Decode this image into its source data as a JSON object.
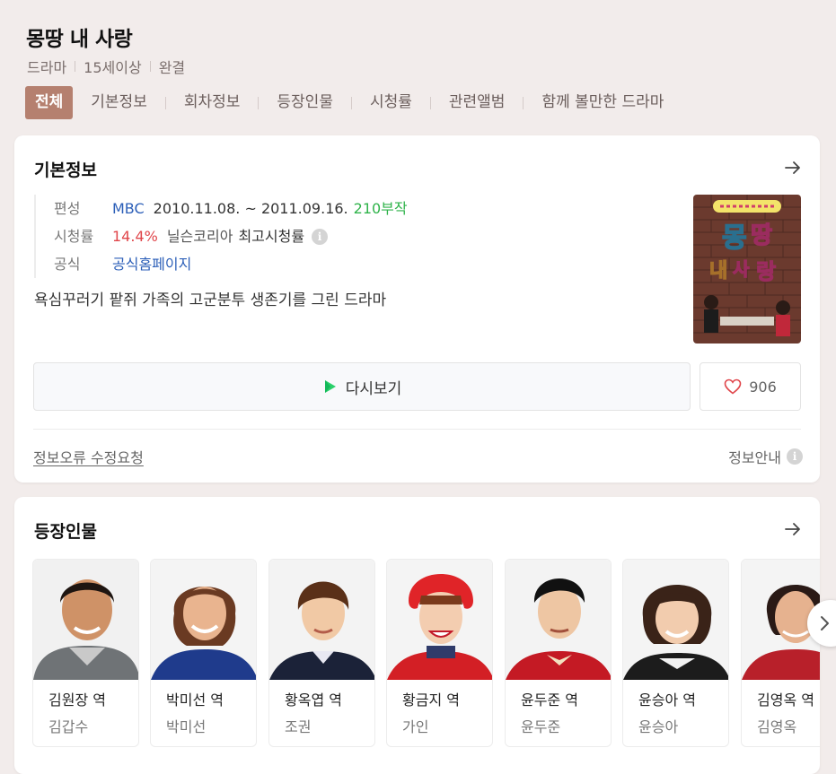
{
  "header": {
    "title": "몽땅 내 사랑",
    "meta": [
      "드라마",
      "15세이상",
      "완결"
    ],
    "tabs": [
      "전체",
      "기본정보",
      "회차정보",
      "등장인물",
      "시청률",
      "관련앨범",
      "함께 볼만한 드라마"
    ],
    "active_tab_index": 0
  },
  "basic_info": {
    "title": "기본정보",
    "rows": {
      "broadcast_key": "편성",
      "channel": "MBC",
      "period": "2010.11.08. ~ 2011.09.16.",
      "episodes": "210부작",
      "rating_key": "시청률",
      "rating": "14.4%",
      "rating_source": "닐슨코리아",
      "rating_type": "최고시청률",
      "official_key": "공식",
      "official_link": "공식홈페이지"
    },
    "description": "욕심꾸러기 팥쥐 가족의 고군분투 생존기를 그린 드라마",
    "poster_icon": "drama-poster",
    "watch_label": "다시보기",
    "like_count": "906",
    "report_label": "정보오류 수정요청",
    "guide_label": "정보안내"
  },
  "cast": {
    "title": "등장인물",
    "members": [
      {
        "role": "김원장 역",
        "actor": "김갑수"
      },
      {
        "role": "박미선 역",
        "actor": "박미선"
      },
      {
        "role": "황옥엽 역",
        "actor": "조권"
      },
      {
        "role": "황금지 역",
        "actor": "가인"
      },
      {
        "role": "윤두준 역",
        "actor": "윤두준"
      },
      {
        "role": "윤승아 역",
        "actor": "윤승아"
      },
      {
        "role": "김영옥 역",
        "actor": "김영옥"
      }
    ]
  },
  "colors": {
    "accent": "#b5806f",
    "channel_link": "#2c5fb8",
    "rating": "#e0454a",
    "episodes": "#2fb34a"
  }
}
